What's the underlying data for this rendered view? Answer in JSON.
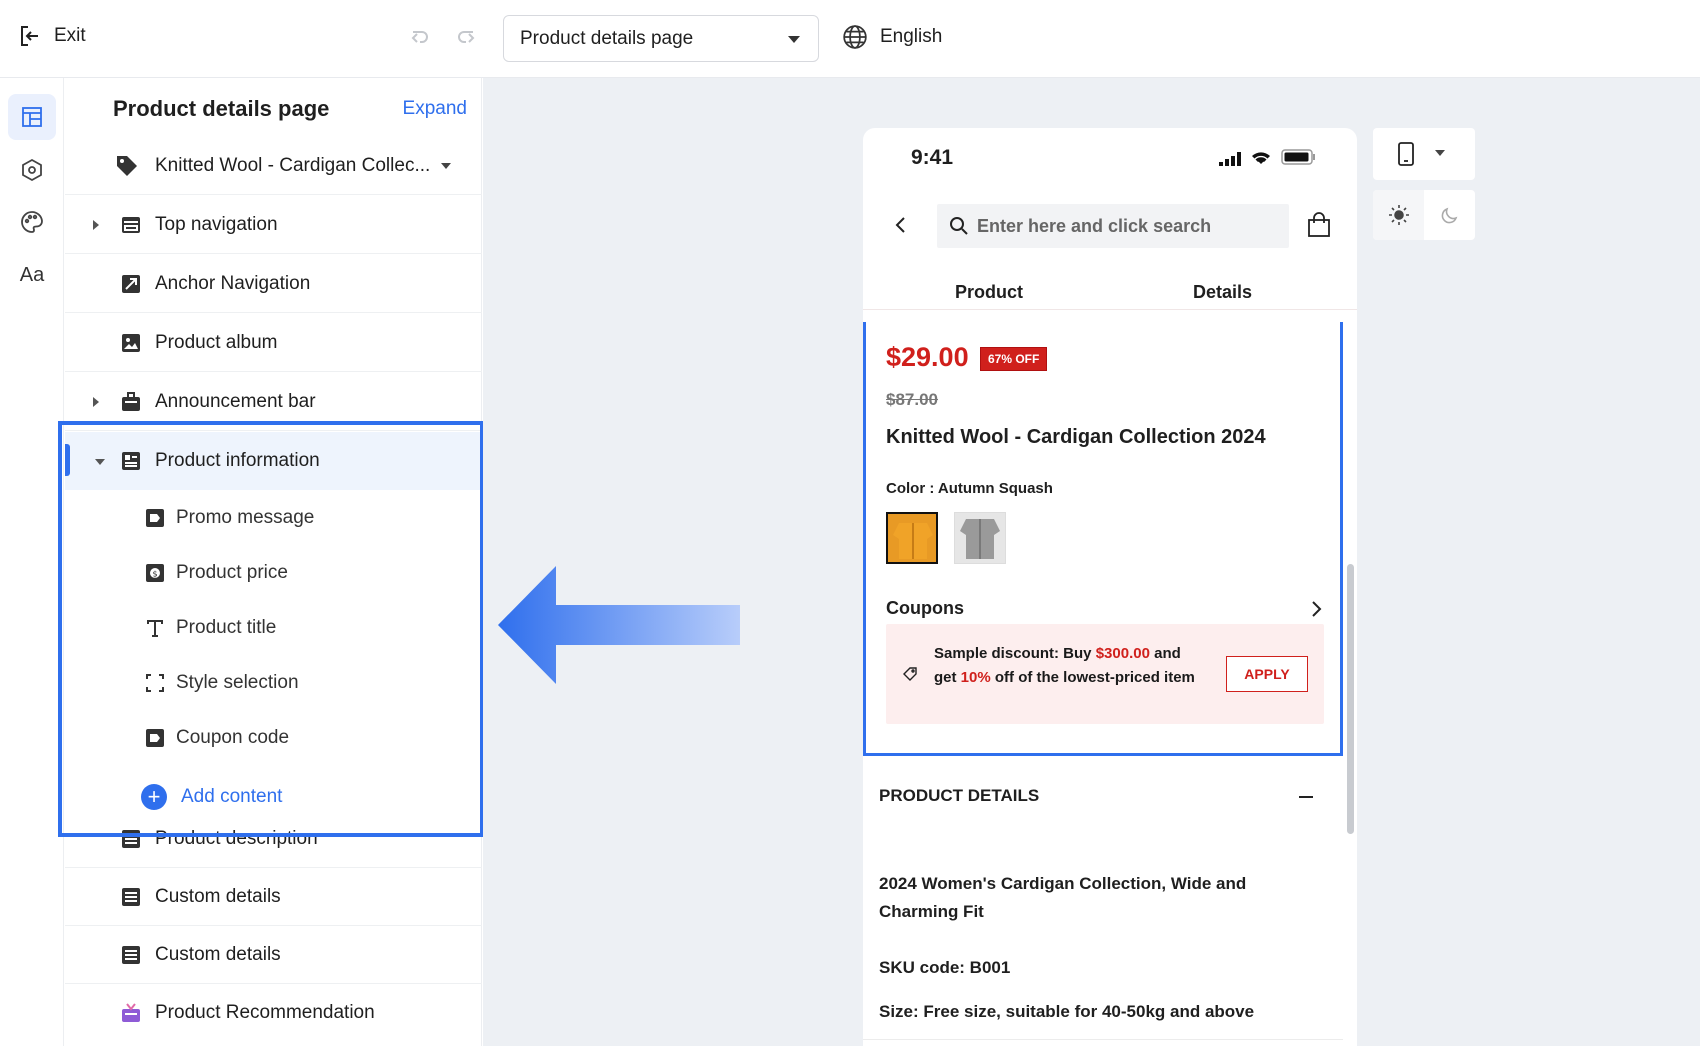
{
  "topbar": {
    "exit_label": "Exit",
    "page_select_value": "Product details page",
    "language": "English"
  },
  "sidebar": {
    "title": "Product details page",
    "expand_label": "Expand",
    "product_select": "Knitted Wool - Cardigan Collec...",
    "items": [
      {
        "label": "Top navigation"
      },
      {
        "label": "Anchor Navigation"
      },
      {
        "label": "Product album"
      },
      {
        "label": "Announcement bar"
      },
      {
        "label": "Product information"
      }
    ],
    "sub_items": [
      {
        "label": "Promo message"
      },
      {
        "label": "Product price"
      },
      {
        "label": "Product title"
      },
      {
        "label": "Style selection"
      },
      {
        "label": "Coupon code"
      }
    ],
    "add_content": "Add content",
    "after_items": [
      {
        "label": "Product description"
      },
      {
        "label": "Custom details"
      },
      {
        "label": "Custom details"
      },
      {
        "label": "Product Recommendation"
      }
    ]
  },
  "rail": {
    "font_icon_text": "Aa"
  },
  "phone": {
    "time": "9:41",
    "search_placeholder": "Enter here and click search",
    "tabs": [
      "Product",
      "Details"
    ],
    "price": "$29.00",
    "discount_badge": "67% OFF",
    "original_price": "$87.00",
    "product_title": "Knitted Wool - Cardigan Collection 2024",
    "color_label": "Color : Autumn Squash",
    "coupons_label": "Coupons",
    "coupon": {
      "text_1": "Sample discount: Buy ",
      "amount": "$300.00",
      "text_2": " and get ",
      "percent": "10%",
      "text_3": " off of the lowest-priced item",
      "apply": "APPLY"
    },
    "details_heading": "PRODUCT DETAILS",
    "description": [
      "2024 Women's Cardigan Collection, Wide and Charming Fit",
      "SKU code: B001",
      "Size: Free size, suitable for 40-50kg and above"
    ]
  },
  "colors": {
    "accent": "#2f6fed",
    "price_red": "#d0201c",
    "canvas_bg": "#edf0f4"
  }
}
